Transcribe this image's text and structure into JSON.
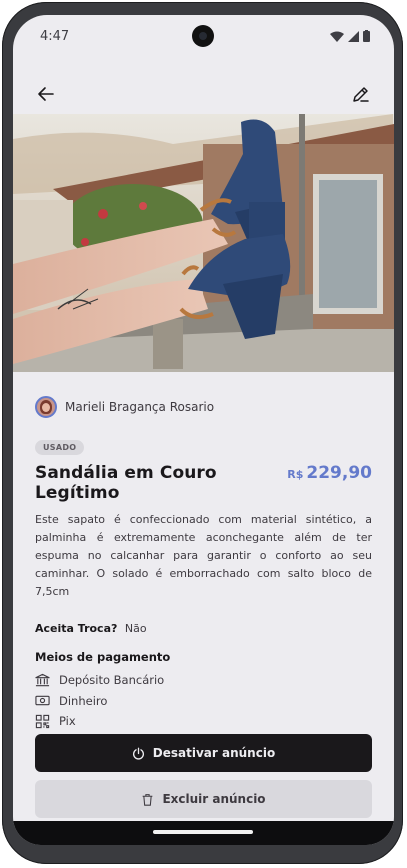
{
  "status_bar": {
    "time": "4:47"
  },
  "seller": {
    "name": "Marieli Bragança Rosario"
  },
  "product": {
    "condition": "USADO",
    "title": "Sandália em Couro Legítimo",
    "currency": "R$",
    "price": "229,90",
    "description": "Este sapato é confeccionado com material sintético, a palminha é extremamente aconchegante além de ter espuma no calcanhar para garantir o conforto ao seu caminhar. O solado é emborrachado com salto bloco de 7,5cm"
  },
  "trade": {
    "label": "Aceita Troca?",
    "value": "Não"
  },
  "payment": {
    "title": "Meios de pagamento",
    "methods": [
      {
        "icon": "bank-icon",
        "label": "Depósito Bancário"
      },
      {
        "icon": "money-icon",
        "label": "Dinheiro"
      },
      {
        "icon": "qr-code-icon",
        "label": "Pix"
      }
    ]
  },
  "actions": {
    "deactivate_label": "Desativar anúncio",
    "delete_label": "Excluir anúncio"
  },
  "colors": {
    "accent": "#647ACB",
    "dark": "#1A181B",
    "background": "#EDECF0",
    "light_button": "#D9D8DD"
  }
}
